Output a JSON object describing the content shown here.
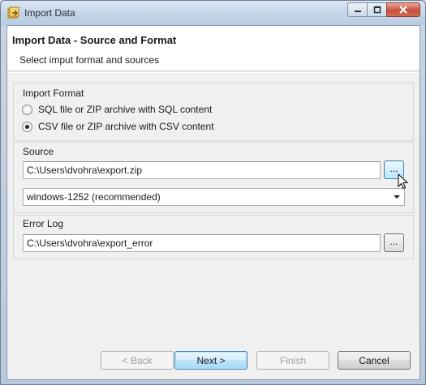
{
  "window": {
    "title": "Import Data",
    "buttons": [
      "minimize",
      "maximize",
      "close"
    ]
  },
  "header": {
    "title": "Import Data - Source and Format",
    "subtitle": "Select imput format and sources"
  },
  "import_format": {
    "label": "Import Format",
    "options": [
      {
        "label": "SQL file or ZIP archive with SQL content",
        "checked": false
      },
      {
        "label": "CSV file or ZIP archive with CSV content",
        "checked": true
      }
    ]
  },
  "source": {
    "label": "Source",
    "path_value": "C:\\Users\\dvohra\\export.zip",
    "browse_label": "...",
    "encoding_value": "windows-1252 (recommended)"
  },
  "error_log": {
    "label": "Error Log",
    "path_value": "C:\\Users\\dvohra\\export_error",
    "browse_label": "..."
  },
  "footer": {
    "back_label": "< Back",
    "next_label": "Next >",
    "finish_label": "Finish",
    "cancel_label": "Cancel"
  },
  "colors": {
    "accent": "#3c7fb1",
    "close_button": "#c7503a"
  }
}
